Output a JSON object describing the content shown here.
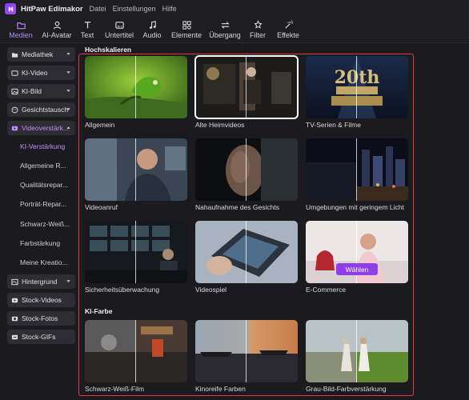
{
  "app": {
    "title": "HitPaw Edimakor",
    "menus": [
      "Datei",
      "Einstellungen",
      "Hilfe"
    ]
  },
  "toolbar": {
    "tabs": [
      {
        "label": "Medien",
        "icon": "folder-icon"
      },
      {
        "label": "AI-Avatar",
        "icon": "avatar-icon"
      },
      {
        "label": "Text",
        "icon": "text-icon"
      },
      {
        "label": "Untertitel",
        "icon": "subtitle-icon"
      },
      {
        "label": "Audio",
        "icon": "music-note-icon"
      },
      {
        "label": "Elemente",
        "icon": "elements-icon"
      },
      {
        "label": "Übergang",
        "icon": "transition-icon"
      },
      {
        "label": "Filter",
        "icon": "filter-icon"
      },
      {
        "label": "Effekte",
        "icon": "effects-icon"
      }
    ],
    "active": "Medien"
  },
  "sidebar": {
    "items": [
      {
        "label": "Mediathek",
        "icon": "folder-icon"
      },
      {
        "label": "KI-Video",
        "icon": "ai-video-icon"
      },
      {
        "label": "KI-Bild",
        "icon": "ai-image-icon"
      },
      {
        "label": "Gesichtstausch",
        "icon": "face-swap-icon"
      },
      {
        "label": "Videoverstärk...",
        "icon": "video-enhance-icon"
      }
    ],
    "subitems": [
      "KI-Verstärkung",
      "Allgemeine R...",
      "Qualitätsrepar...",
      "Porträt-Repar...",
      "Schwarz-Weiß...",
      "Farbstärkung",
      "Meine Kreatio..."
    ],
    "bottom_items": [
      {
        "label": "Hintergrund",
        "icon": "background-icon"
      },
      {
        "label": "Stock-Videos",
        "icon": "stock-video-icon"
      },
      {
        "label": "Stock-Fotos",
        "icon": "stock-photo-icon"
      },
      {
        "label": "Stock-GIFs",
        "icon": "stock-gif-icon"
      }
    ]
  },
  "sections": {
    "upscale_title": "Hochskalieren",
    "color_title": "KI-Farbe"
  },
  "cards": {
    "c1": "Allgemein",
    "c2": "Alte Heimvideos",
    "c3": "TV-Serien & Filme",
    "c4": "Videoanruf",
    "c5": "Nahaufnahme des Gesichts",
    "c6": "Umgebungen mit geringem Licht",
    "c7": "Sicherheitsüberwachung",
    "c8": "Videospiel",
    "c9": "E-Commerce",
    "c10": "Schwarz-Weiß-Film",
    "c11": "Kinoreife Farben",
    "c12": "Grau-Bild-Farbverstärkung"
  },
  "select_button": "Wählen",
  "colors": {
    "accent": "#b787ff",
    "button": "#8e3fe8",
    "highlight_frame": "#e23b3b"
  }
}
